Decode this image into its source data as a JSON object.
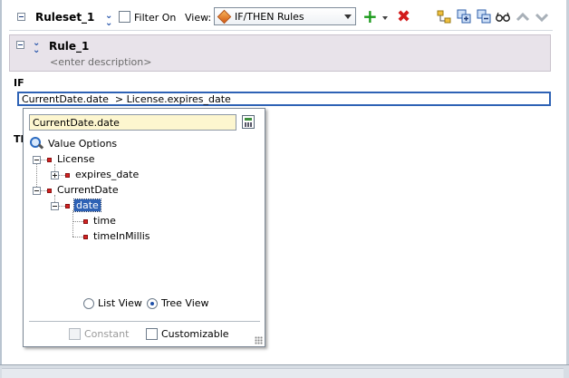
{
  "toolbar": {
    "ruleset_name": "Ruleset_1",
    "filter_label": "Filter On",
    "view_label": "View:",
    "view_selected": "IF/THEN Rules"
  },
  "rule": {
    "name": "Rule_1",
    "description_placeholder": "<enter description>"
  },
  "sections": {
    "if_label": "IF",
    "then_label": "TH"
  },
  "condition": {
    "expression": "CurrentDate.date  > License.expires_date"
  },
  "popup": {
    "input_value": "CurrentDate.date",
    "value_options_label": "Value Options",
    "tree": {
      "license": "License",
      "expires_date": "expires_date",
      "current_date": "CurrentDate",
      "date": "date",
      "time": "time",
      "time_in_millis": "timeInMillis"
    },
    "list_view_label": "List View",
    "tree_view_label": "Tree View",
    "view_mode": "Tree View",
    "constant_label": "Constant",
    "customizable_label": "Customizable"
  },
  "icons": {
    "add": "plus-icon",
    "delete": "delete-icon",
    "view": "glasses-icon",
    "move_up": "chevron-up-icon",
    "move_down": "chevron-down-icon"
  },
  "colors": {
    "selection": "#2e62b5",
    "rule_header_bg": "#e8e3ea",
    "input_bg": "#fdf6cf",
    "add_green": "#1c9a1c",
    "delete_red": "#d21b1b"
  }
}
